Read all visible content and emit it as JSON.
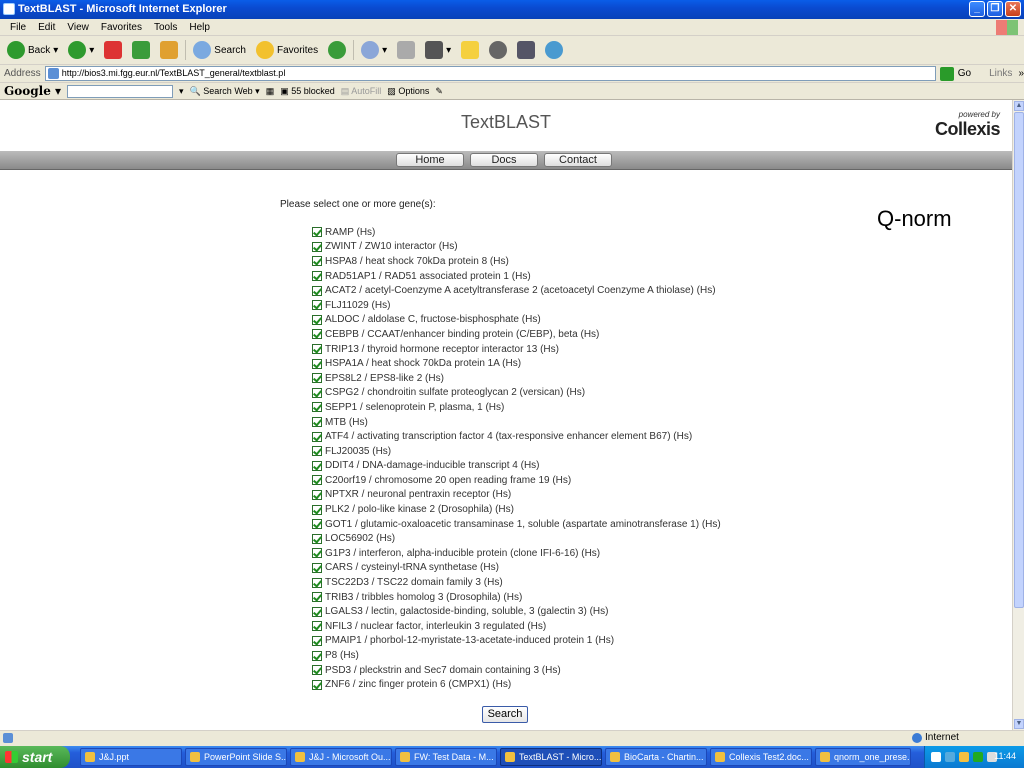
{
  "window": {
    "title": "TextBLAST - Microsoft Internet Explorer"
  },
  "menu": [
    "File",
    "Edit",
    "View",
    "Favorites",
    "Tools",
    "Help"
  ],
  "toolbar": {
    "back": "Back",
    "search": "Search",
    "favorites": "Favorites"
  },
  "address": {
    "label": "Address",
    "url": "http://bios3.mi.fgg.eur.nl/TextBLAST_general/textblast.pl",
    "go": "Go",
    "links": "Links"
  },
  "googlebar": {
    "logo": "Google",
    "search_web": "Search Web",
    "blocked": "55 blocked",
    "autofill": "AutoFill",
    "options": "Options"
  },
  "page": {
    "title": "TextBLAST",
    "powered_by": "powered by",
    "brand": "Collexis",
    "nav": [
      "Home",
      "Docs",
      "Contact"
    ],
    "prompt": "Please select one or more gene(s):",
    "annotation": "Q-norm",
    "genes": [
      "RAMP (Hs)",
      "ZWINT / ZW10 interactor (Hs)",
      "HSPA8 / heat shock 70kDa protein 8 (Hs)",
      "RAD51AP1 / RAD51 associated protein 1 (Hs)",
      "ACAT2 / acetyl-Coenzyme A acetyltransferase 2 (acetoacetyl Coenzyme A thiolase) (Hs)",
      "FLJ11029 (Hs)",
      "ALDOC / aldolase C, fructose-bisphosphate (Hs)",
      "CEBPB / CCAAT/enhancer binding protein (C/EBP), beta (Hs)",
      "TRIP13 / thyroid hormone receptor interactor 13 (Hs)",
      "HSPA1A / heat shock 70kDa protein 1A (Hs)",
      "EPS8L2 / EPS8-like 2 (Hs)",
      "CSPG2 / chondroitin sulfate proteoglycan 2 (versican) (Hs)",
      "SEPP1 / selenoprotein P, plasma, 1 (Hs)",
      "MTB (Hs)",
      "ATF4 / activating transcription factor 4 (tax-responsive enhancer element B67) (Hs)",
      "FLJ20035 (Hs)",
      "DDIT4 / DNA-damage-inducible transcript 4 (Hs)",
      "C20orf19 / chromosome 20 open reading frame 19 (Hs)",
      "NPTXR / neuronal pentraxin receptor (Hs)",
      "PLK2 / polo-like kinase 2 (Drosophila) (Hs)",
      "GOT1 / glutamic-oxaloacetic transaminase 1, soluble (aspartate aminotransferase 1) (Hs)",
      "LOC56902 (Hs)",
      "G1P3 / interferon, alpha-inducible protein (clone IFI-6-16) (Hs)",
      "CARS / cysteinyl-tRNA synthetase (Hs)",
      "TSC22D3 / TSC22 domain family 3 (Hs)",
      "TRIB3 / tribbles homolog 3 (Drosophila) (Hs)",
      "LGALS3 / lectin, galactoside-binding, soluble, 3 (galectin 3) (Hs)",
      "NFIL3 / nuclear factor, interleukin 3 regulated (Hs)",
      "PMAIP1 / phorbol-12-myristate-13-acetate-induced protein 1 (Hs)",
      "P8 (Hs)",
      "PSD3 / pleckstrin and Sec7 domain containing 3 (Hs)",
      "ZNF6 / zinc finger protein 6 (CMPX1) (Hs)"
    ],
    "search_button": "Search"
  },
  "status": {
    "zone": "Internet"
  },
  "taskbar": {
    "start": "start",
    "tasks": [
      "J&J.ppt",
      "PowerPoint Slide S...",
      "J&J - Microsoft Ou...",
      "FW: Test Data - M...",
      "TextBLAST - Micro...",
      "BioCarta - Chartin...",
      "Collexis Test2.doc...",
      "qnorm_one_prese..."
    ],
    "clock": "11:44"
  }
}
